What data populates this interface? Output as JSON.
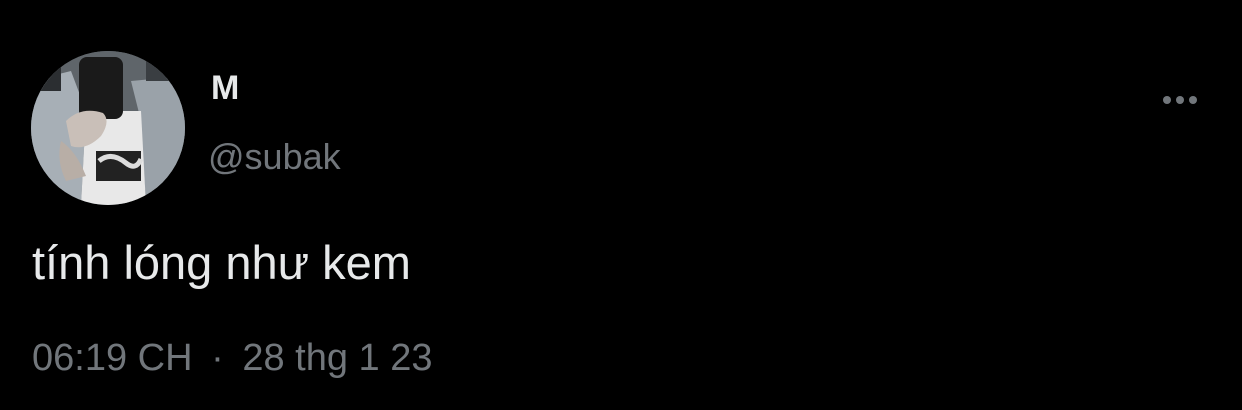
{
  "tweet": {
    "author": {
      "display_name": "M",
      "handle": "@subak",
      "avatar_icon": "profile-photo"
    },
    "text": "tính lóng như kem",
    "time": "06:19 CH",
    "separator": "·",
    "date": "28 thg 1 23",
    "more_icon": "ellipsis-icon"
  },
  "colors": {
    "background": "#000000",
    "primary_text": "#e7e9ea",
    "secondary_text": "#71767b"
  }
}
